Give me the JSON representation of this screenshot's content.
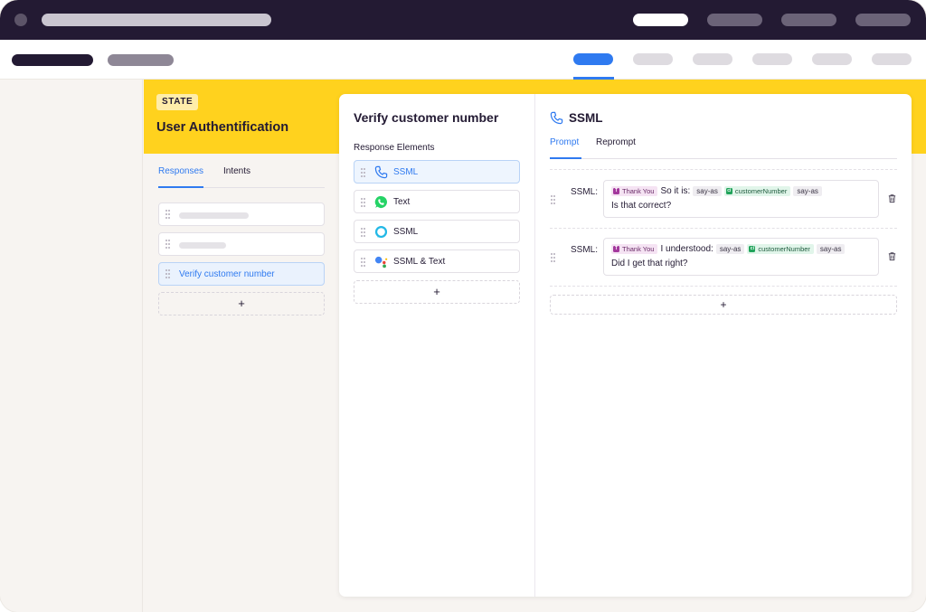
{
  "state_panel": {
    "badge": "STATE",
    "title": "User Authentification",
    "tabs": [
      "Responses",
      "Intents"
    ],
    "responses": [
      {
        "label": "",
        "placeholder": true
      },
      {
        "label": "",
        "placeholder": true
      },
      {
        "label": "Verify customer number",
        "selected": true
      }
    ],
    "add_label": "+"
  },
  "card": {
    "title": "Verify customer number",
    "elements_label": "Response Elements",
    "elements": [
      {
        "label": "SSML",
        "icon": "phone-icon",
        "selected": true
      },
      {
        "label": "Text",
        "icon": "whatsapp-icon"
      },
      {
        "label": "SSML",
        "icon": "alexa-icon"
      },
      {
        "label": "SSML & Text",
        "icon": "google-assistant-icon"
      }
    ],
    "add_label": "+"
  },
  "detail": {
    "icon": "phone-icon",
    "title": "SSML",
    "tabs": [
      "Prompt",
      "Reprompt"
    ],
    "prompts": [
      {
        "key": "SSML:",
        "tag1": "Thank You",
        "text1": "So it is:",
        "sayas1": "say-as",
        "tag2": "customerNumber",
        "sayas2": "say-as",
        "line2": "Is that correct?"
      },
      {
        "key": "SSML:",
        "tag1": "Thank You",
        "text1": "I understood:",
        "sayas1": "say-as",
        "tag2": "customerNumber",
        "sayas2": "say-as",
        "line2": "Did I get that right?"
      }
    ],
    "add_label": "+"
  },
  "colors": {
    "accent": "#2f7af0",
    "yellow": "#ffd21e",
    "dark": "#231a33"
  }
}
